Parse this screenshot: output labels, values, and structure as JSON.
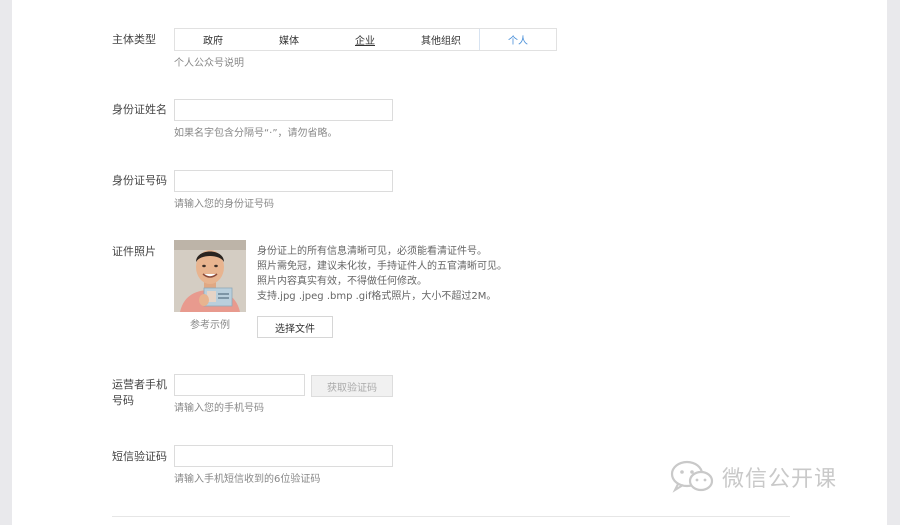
{
  "subject_type": {
    "label": "主体类型",
    "tabs": [
      "政府",
      "媒体",
      "企业",
      "其他组织",
      "个人"
    ],
    "selected_index": 4,
    "description": "个人公众号说明"
  },
  "id_name": {
    "label": "身份证姓名",
    "value": "",
    "hint": "如果名字包含分隔号“·”，请勿省略。"
  },
  "id_number": {
    "label": "身份证号码",
    "value": "",
    "hint": "请输入您的身份证号码"
  },
  "id_photo": {
    "label": "证件照片",
    "caption": "参考示例",
    "upload_label": "选择文件",
    "requirements": [
      "身份证上的所有信息清晰可见，必须能看清证件号。",
      "照片需免冠，建议未化妆，手持证件人的五官清晰可见。",
      "照片内容真实有效，不得做任何修改。",
      "支持.jpg .jpeg .bmp .gif格式照片，大小不超过2M。"
    ]
  },
  "phone": {
    "label_line1": "运营者手机",
    "label_line2": "号码",
    "value": "",
    "hint": "请输入您的手机号码",
    "get_code_label": "获取验证码"
  },
  "sms_code": {
    "label": "短信验证码",
    "value": "",
    "hint": "请输入手机短信收到的6位验证码"
  },
  "watermark": {
    "text": "微信公开课",
    "icon": "wechat-logo-icon"
  }
}
